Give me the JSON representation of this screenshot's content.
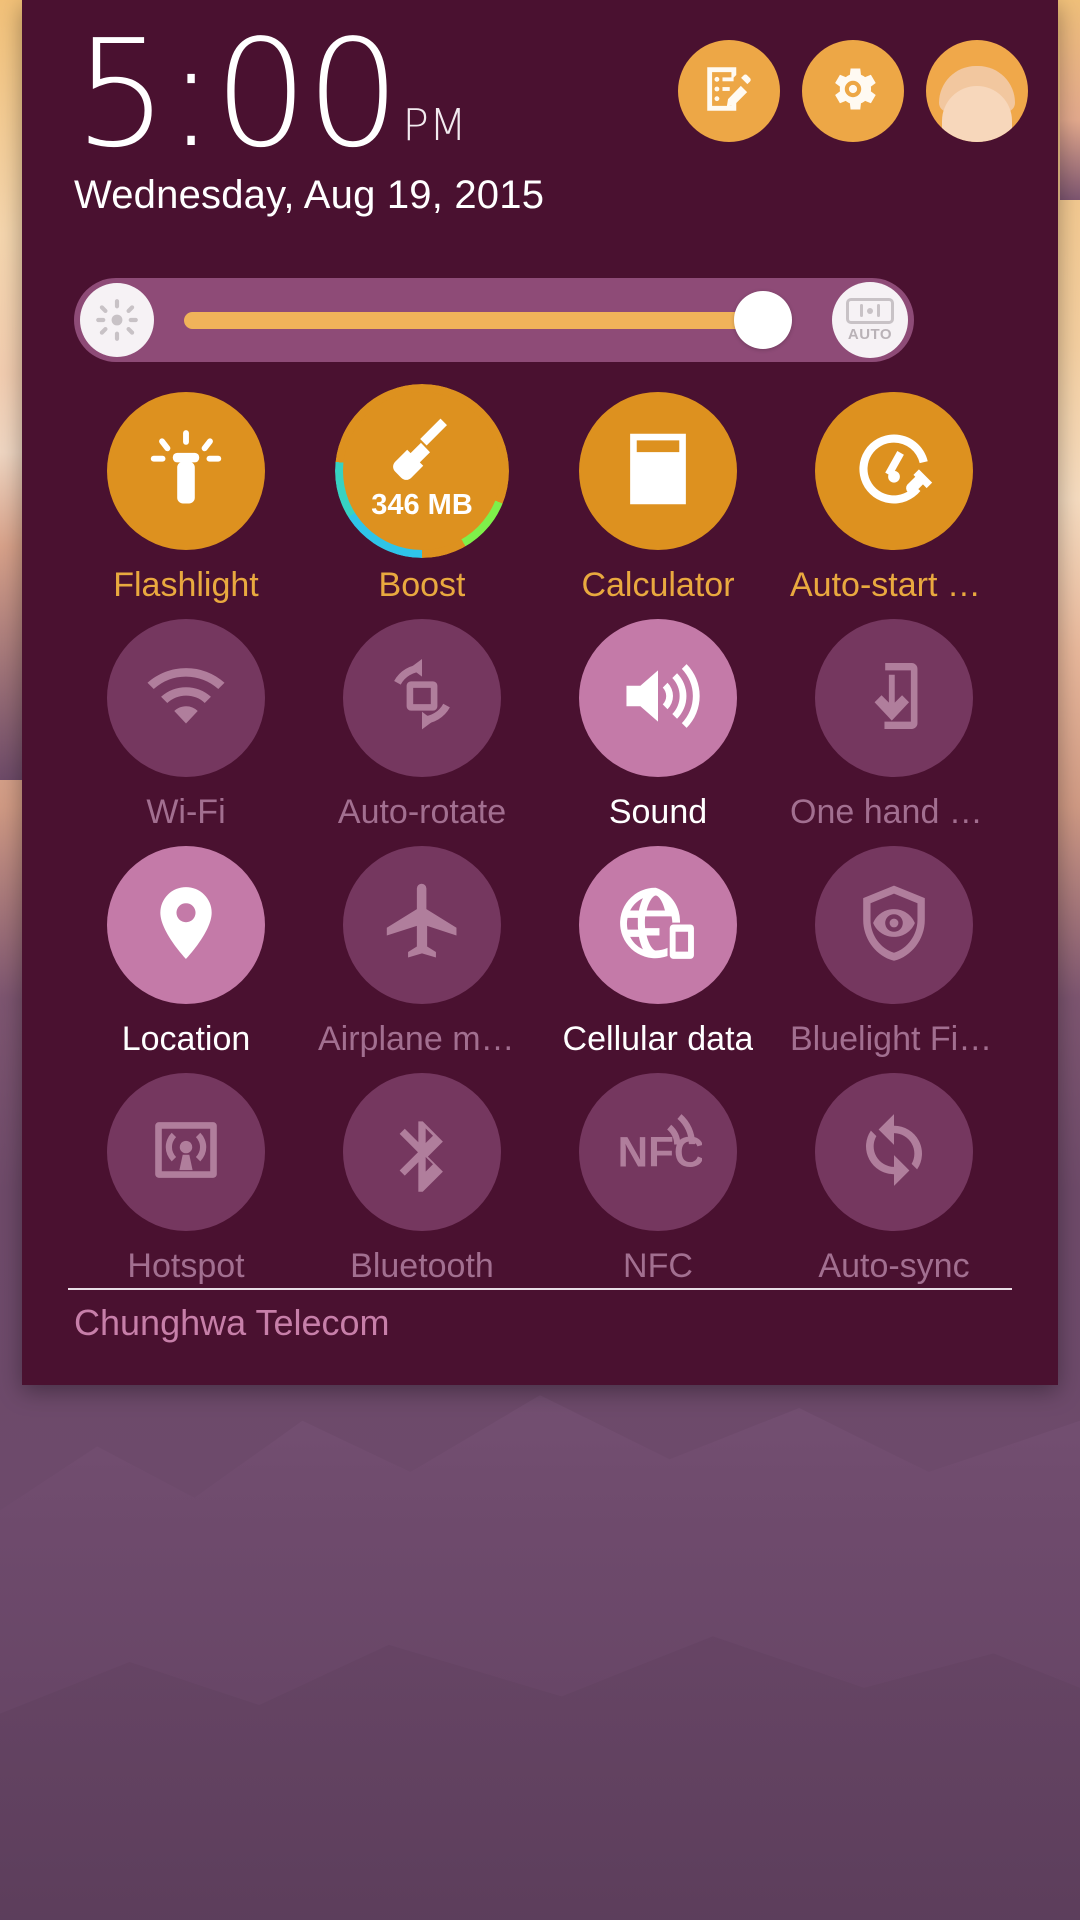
{
  "status": {
    "time": "5:00",
    "ampm": "PM",
    "date": "Wednesday, Aug 19, 2015"
  },
  "top_actions": [
    {
      "name": "notes-edit-button",
      "icon": "note-edit-icon",
      "label": "Notes"
    },
    {
      "name": "settings-button",
      "icon": "gear-icon",
      "label": "Settings"
    },
    {
      "name": "user-avatar-button",
      "icon": "user-avatar-icon",
      "label": "User"
    }
  ],
  "brightness": {
    "icon": "brightness-icon",
    "auto_icon": "auto-brightness-icon",
    "auto_label": "AUTO",
    "value": 92,
    "fill_color": "#f0b35a",
    "track_color": "#8e4b77"
  },
  "tiles": [
    {
      "label": "Flashlight",
      "icon": "flashlight-icon",
      "state": "app"
    },
    {
      "label": "Boost",
      "icon": "boost-broom-icon",
      "state": "app",
      "badge": "346 MB"
    },
    {
      "label": "Calculator",
      "icon": "calculator-icon",
      "state": "app"
    },
    {
      "label": "Auto-start M...",
      "icon": "auto-start-icon",
      "state": "app"
    },
    {
      "label": "Wi-Fi",
      "icon": "wifi-icon",
      "state": "off"
    },
    {
      "label": "Auto-rotate",
      "icon": "auto-rotate-icon",
      "state": "off"
    },
    {
      "label": "Sound",
      "icon": "sound-icon",
      "state": "on"
    },
    {
      "label": "One hand op...",
      "icon": "one-hand-icon",
      "state": "off"
    },
    {
      "label": "Location",
      "icon": "location-pin-icon",
      "state": "on"
    },
    {
      "label": "Airplane mo...",
      "icon": "airplane-icon",
      "state": "off"
    },
    {
      "label": "Cellular data",
      "icon": "cellular-data-icon",
      "state": "on"
    },
    {
      "label": "Bluelight Filter",
      "icon": "bluelight-shield-icon",
      "state": "off"
    },
    {
      "label": "Hotspot",
      "icon": "hotspot-icon",
      "state": "off"
    },
    {
      "label": "Bluetooth",
      "icon": "bluetooth-icon",
      "state": "off"
    },
    {
      "label": "NFC",
      "icon": "nfc-icon",
      "state": "off"
    },
    {
      "label": "Auto-sync",
      "icon": "auto-sync-icon",
      "state": "off"
    }
  ],
  "footer": {
    "carrier": "Chunghwa Telecom"
  },
  "colors": {
    "panel_bg": "#4a1130",
    "accent_orange": "#dd911f",
    "label_orange": "#e9a93f",
    "tile_on": "#c47aa8",
    "tile_off": "#75375f",
    "carrier_text": "#c77fa9"
  }
}
